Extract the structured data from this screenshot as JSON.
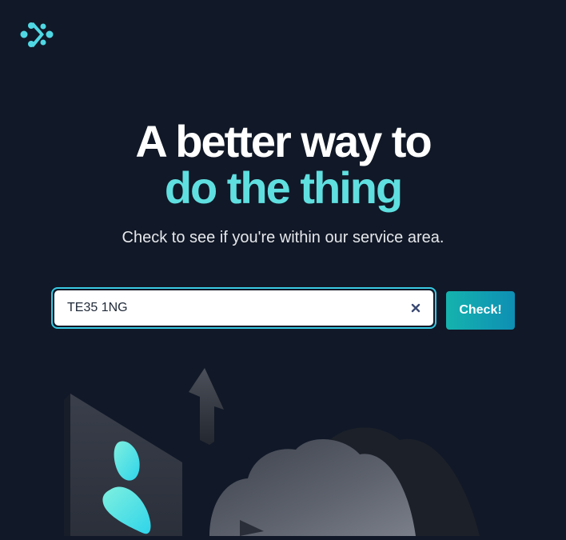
{
  "brand": {
    "logo_icon": "brand-logo-icon",
    "accent_color": "#5fdfe0"
  },
  "hero": {
    "headline_line1": "A better way to",
    "headline_line2": "do the thing",
    "subtitle": "Check to see if you're within our service area."
  },
  "search": {
    "value": "TE35 1NG",
    "clear_icon": "close-icon",
    "button_label": "Check!"
  },
  "colors": {
    "background": "#111827",
    "input_border": "#38c9e2",
    "button_gradient_start": "#15b3ae",
    "button_gradient_end": "#0e8fb4"
  },
  "illustration": {
    "icons": [
      "person-icon",
      "arrow-up-icon",
      "cloud-icon"
    ]
  }
}
